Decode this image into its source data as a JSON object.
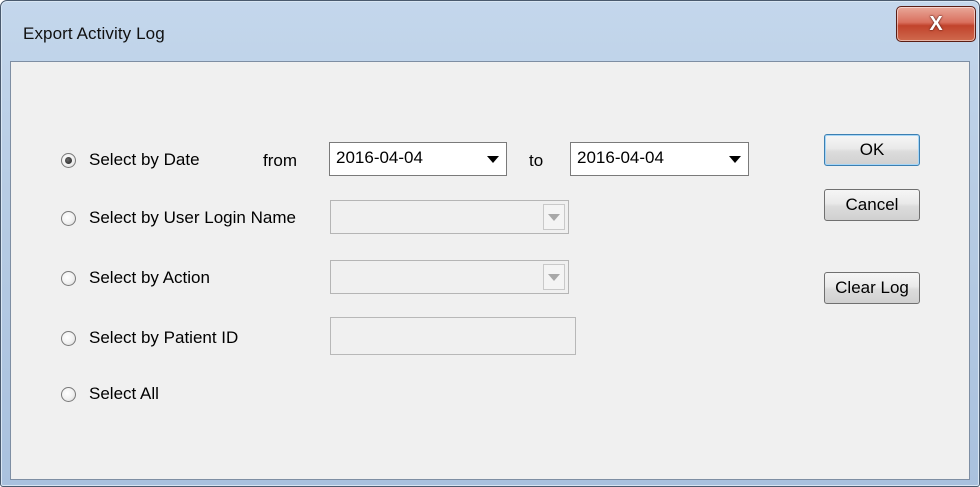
{
  "window": {
    "title": "Export Activity Log",
    "close_label": "X"
  },
  "options": {
    "by_date": {
      "label": "Select by Date",
      "checked": true
    },
    "by_user": {
      "label": "Select by User Login Name",
      "checked": false
    },
    "by_action": {
      "label": "Select by Action",
      "checked": false
    },
    "by_patient": {
      "label": "Select by Patient ID",
      "checked": false
    },
    "all": {
      "label": "Select All",
      "checked": false
    }
  },
  "date_range": {
    "from_label": "from",
    "from_value": "2016-04-04",
    "to_label": "to",
    "to_value": "2016-04-04"
  },
  "user_combo": {
    "value": "",
    "enabled": false
  },
  "action_combo": {
    "value": "",
    "enabled": false
  },
  "patient_input": {
    "value": "",
    "enabled": false
  },
  "buttons": {
    "ok": "OK",
    "cancel": "Cancel",
    "clear_log": "Clear Log"
  },
  "icons": {
    "close": "close-icon",
    "dropdown": "chevron-down-icon"
  }
}
